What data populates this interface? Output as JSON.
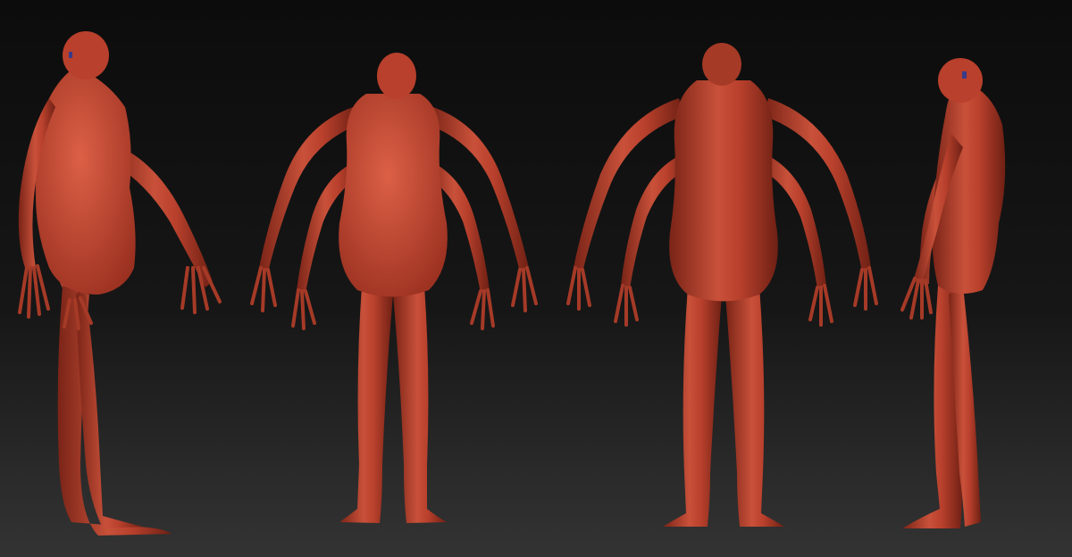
{
  "scene": {
    "colors": {
      "background_top": "#0c0c0c",
      "background_bottom": "#333333",
      "skin": "#b8402c",
      "skin_highlight": "#d55a40",
      "skin_shadow": "#7a2417",
      "wire": "#3a0e08"
    },
    "figures": [
      {
        "view": "side-left"
      },
      {
        "view": "front"
      },
      {
        "view": "back"
      },
      {
        "view": "side-right"
      }
    ]
  }
}
